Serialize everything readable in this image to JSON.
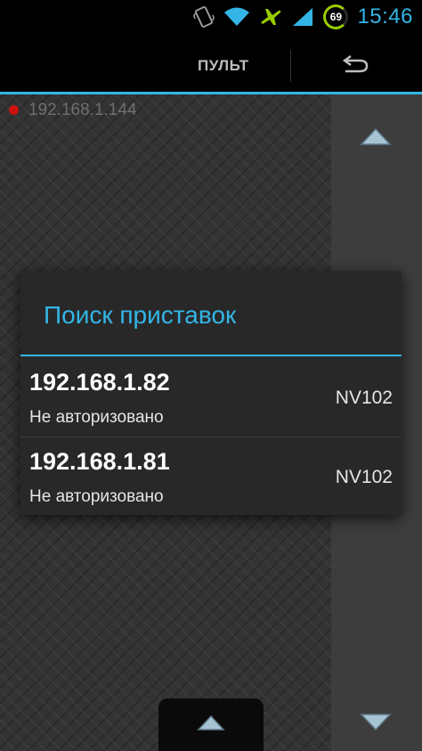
{
  "status_bar": {
    "time": "15:46",
    "battery_level": "69",
    "icons": [
      "vibrate-icon",
      "wifi-icon",
      "airplane-icon",
      "signal-icon",
      "battery-icon"
    ]
  },
  "action_bar": {
    "title": "ПУЛЬТ",
    "back_icon": "undo-icon"
  },
  "connection": {
    "ip": "192.168.1.144",
    "status_color": "#cc1111"
  },
  "dialog": {
    "title": "Поиск приставок",
    "devices": [
      {
        "ip": "192.168.1.82",
        "status": "Не авторизовано",
        "model": "NV102"
      },
      {
        "ip": "192.168.1.81",
        "status": "Не авторизовано",
        "model": "NV102"
      }
    ]
  },
  "colors": {
    "accent": "#33b5e5",
    "battery_ring": "#99cc00",
    "background": "#333333"
  }
}
